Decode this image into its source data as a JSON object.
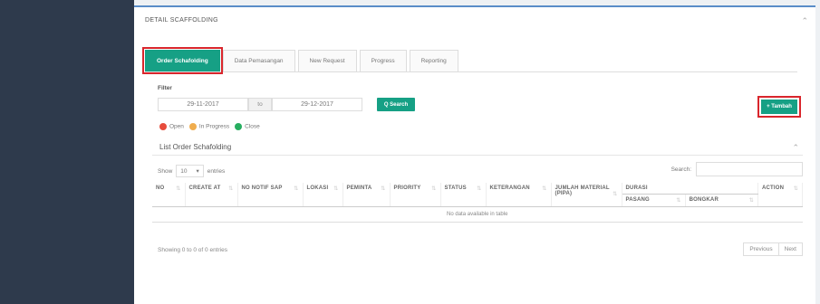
{
  "panel": {
    "title": "DETAIL SCAFFOLDING",
    "collapse_icon": "chevron-up-icon"
  },
  "tabs": [
    {
      "label": "Order Schafolding",
      "active": true
    },
    {
      "label": "Data Pemasangan",
      "active": false
    },
    {
      "label": "New Request",
      "active": false
    },
    {
      "label": "Progress",
      "active": false
    },
    {
      "label": "Reporting",
      "active": false
    }
  ],
  "filter": {
    "label": "Filter",
    "date_from": "29-11-2017",
    "to_label": "to",
    "date_to": "29-12-2017",
    "search_button": "Q Search"
  },
  "add_button": "+ Tambah",
  "legend": [
    {
      "label": "Open",
      "color": "#e74c3c"
    },
    {
      "label": "In Progress",
      "color": "#f0ad4e"
    },
    {
      "label": "Close",
      "color": "#27ae60"
    }
  ],
  "list": {
    "title": "List Order Schafolding",
    "show_label": "Show",
    "entries_value": "10",
    "entries_label": "entries",
    "search_label": "Search:",
    "columns": [
      "NO",
      "CREATE AT",
      "NO NOTIF SAP",
      "LOKASI",
      "PEMINTA",
      "PRIORITY",
      "STATUS",
      "KETERANGAN",
      "JUMLAH MATERIAL (PIPA)",
      "DURASI",
      "ACTION"
    ],
    "durasi_sub": [
      "PASANG",
      "BONGKAR"
    ],
    "empty_message": "No data available in table",
    "showing": "Showing 0 to 0 of 0 entries",
    "prev": "Previous",
    "next": "Next"
  }
}
